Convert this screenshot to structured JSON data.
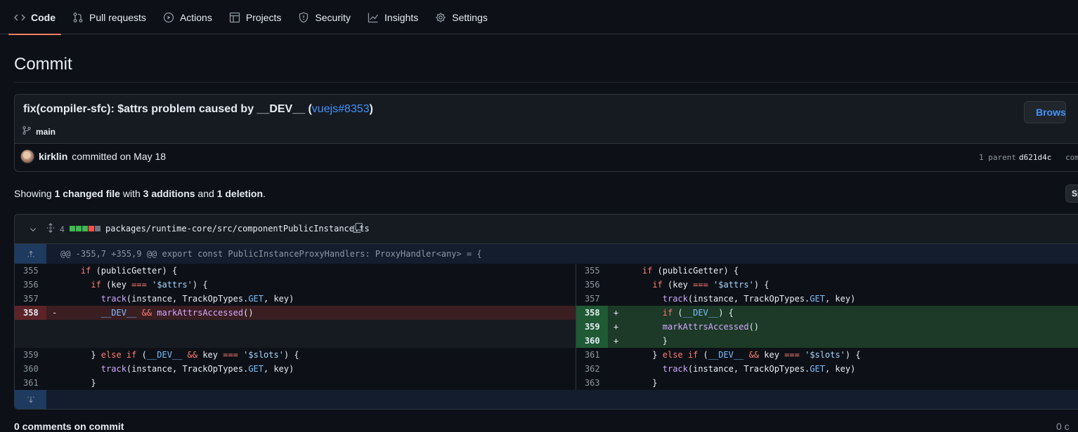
{
  "nav": {
    "tabs": [
      {
        "label": "Code",
        "icon": "code-icon"
      },
      {
        "label": "Pull requests",
        "icon": "git-pull-request-icon"
      },
      {
        "label": "Actions",
        "icon": "play-icon"
      },
      {
        "label": "Projects",
        "icon": "table-icon"
      },
      {
        "label": "Security",
        "icon": "shield-icon"
      },
      {
        "label": "Insights",
        "icon": "graph-icon"
      },
      {
        "label": "Settings",
        "icon": "gear-icon"
      }
    ],
    "active": "Code"
  },
  "page": {
    "title": "Commit"
  },
  "commit": {
    "message": "fix(compiler-sfc): $attrs problem caused by __DEV__ (",
    "ref_link": "vuejs#8353",
    "message_end": ")",
    "branch": "main",
    "browse_label": "Browse files",
    "author": "kirklin",
    "committed_text": "committed on May 18",
    "parent_label": "1 parent",
    "parent_sha": "d621d4c",
    "commit_label": "commit"
  },
  "summary": {
    "prefix": "Showing ",
    "files": "1 changed file",
    "mid1": " with ",
    "additions": "3 additions",
    "mid2": " and ",
    "deletions": "1 deletion",
    "suffix": ".",
    "view_button": "Split"
  },
  "file": {
    "changes_count": "4",
    "path": "packages/runtime-core/src/componentPublicInstance.ts",
    "hunk_header": "@@ -355,7 +355,9 @@ export const PublicInstanceProxyHandlers: ProxyHandler<any> = {",
    "left_numbers": [
      "355",
      "356",
      "357",
      "358",
      "",
      "",
      "359",
      "360",
      "361"
    ],
    "right_numbers": [
      "355",
      "356",
      "357",
      "358",
      "359",
      "360",
      "361",
      "362",
      "363"
    ],
    "left_markers": [
      "",
      "",
      "",
      "-",
      "",
      "",
      "",
      "",
      ""
    ],
    "right_markers": [
      "",
      "",
      "",
      "+",
      "+",
      "+",
      "",
      "",
      ""
    ]
  },
  "colors": {
    "background": "#0d1117",
    "accent_blue": "#4493f8",
    "addition": "#3fb950",
    "deletion": "#f85149",
    "tab_underline": "#f78166"
  },
  "footer": {
    "comments_text": "0 comments on commit",
    "right_text": "0 c"
  }
}
